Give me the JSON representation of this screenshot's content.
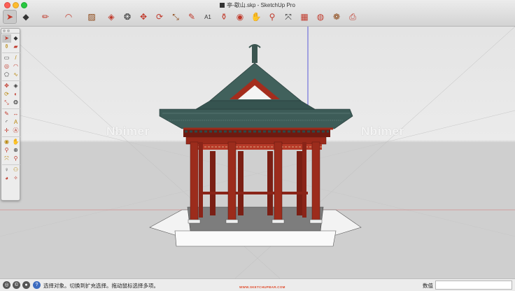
{
  "window": {
    "title": "亭-歇山.skp - SketchUp Pro"
  },
  "toolbar": {
    "items": [
      {
        "name": "select-tool",
        "glyph": "➤",
        "active": true
      },
      {
        "name": "eraser-tool",
        "glyph": "◆"
      },
      {
        "name": "line-tool",
        "glyph": "✏"
      },
      {
        "name": "arc-tool",
        "glyph": "◠"
      },
      {
        "name": "shape-tool",
        "glyph": "▨"
      },
      {
        "name": "push-pull-tool",
        "glyph": "◈"
      },
      {
        "name": "offset-tool",
        "glyph": "❂"
      },
      {
        "name": "move-tool",
        "glyph": "✥"
      },
      {
        "name": "rotate-tool",
        "glyph": "⟳"
      },
      {
        "name": "scale-tool",
        "glyph": "⤡"
      },
      {
        "name": "tape-measure-tool",
        "glyph": "✎"
      },
      {
        "name": "text-tool",
        "glyph": "A1"
      },
      {
        "name": "paint-bucket-tool",
        "glyph": "⚱"
      },
      {
        "name": "orbit-tool",
        "glyph": "◉"
      },
      {
        "name": "pan-tool",
        "glyph": "✋"
      },
      {
        "name": "zoom-tool",
        "glyph": "⚲"
      },
      {
        "name": "zoom-extents-tool",
        "glyph": "⤧"
      },
      {
        "name": "warehouse-tool",
        "glyph": "▦"
      },
      {
        "name": "extension-warehouse-tool",
        "glyph": "◍"
      },
      {
        "name": "components-tool",
        "glyph": "❁"
      },
      {
        "name": "send-to-layout-tool",
        "glyph": "⎙"
      }
    ]
  },
  "palette": {
    "items": [
      {
        "name": "select-tool",
        "glyph": "➤"
      },
      {
        "name": "make-component-tool",
        "glyph": "◆"
      },
      {
        "name": "paint-bucket-tool",
        "glyph": "⚱"
      },
      {
        "name": "eraser-tool",
        "glyph": "▰"
      },
      {
        "sep": true
      },
      {
        "name": "rectangle-tool",
        "glyph": "▭"
      },
      {
        "name": "line-tool",
        "glyph": "/"
      },
      {
        "name": "circle-tool",
        "glyph": "◎"
      },
      {
        "name": "arc-tool",
        "glyph": "◠"
      },
      {
        "name": "polygon-tool",
        "glyph": "⬠"
      },
      {
        "name": "freehand-tool",
        "glyph": "∿"
      },
      {
        "sep": true
      },
      {
        "name": "move-tool",
        "glyph": "✥"
      },
      {
        "name": "push-pull-tool",
        "glyph": "◈"
      },
      {
        "name": "rotate-tool",
        "glyph": "⟳"
      },
      {
        "name": "follow-me-tool",
        "glyph": "◐"
      },
      {
        "name": "scale-tool",
        "glyph": "⤡"
      },
      {
        "name": "offset-tool",
        "glyph": "❂"
      },
      {
        "sep": true
      },
      {
        "name": "tape-measure-tool",
        "glyph": "✎"
      },
      {
        "name": "dimension-tool",
        "glyph": "↔"
      },
      {
        "name": "protractor-tool",
        "glyph": "◜"
      },
      {
        "name": "text-tool",
        "glyph": "A"
      },
      {
        "name": "axes-tool",
        "glyph": "✛"
      },
      {
        "name": "3d-text-tool",
        "glyph": "Ⓐ"
      },
      {
        "sep": true
      },
      {
        "name": "orbit-tool",
        "glyph": "◉"
      },
      {
        "name": "pan-tool",
        "glyph": "✋"
      },
      {
        "name": "zoom-tool",
        "glyph": "⚲"
      },
      {
        "name": "zoom-window-tool",
        "glyph": "⊕"
      },
      {
        "name": "zoom-extents-tool",
        "glyph": "⤧"
      },
      {
        "name": "previous-view-tool",
        "glyph": "⚲"
      },
      {
        "sep": true
      },
      {
        "name": "position-camera-tool",
        "glyph": "♀"
      },
      {
        "name": "walk-tool",
        "glyph": "⚇"
      },
      {
        "name": "look-around-tool",
        "glyph": "◕"
      },
      {
        "name": "section-plane-tool",
        "glyph": "✧"
      }
    ]
  },
  "viewport": {
    "watermark_text": "Nbimer"
  },
  "status": {
    "hint": "选择对象。切换到扩充选择。拖动鼠标选择多项。",
    "url": "WWW.SKETCHUPBAR.COM",
    "measurements_label": "数值",
    "measurements_value": ""
  }
}
